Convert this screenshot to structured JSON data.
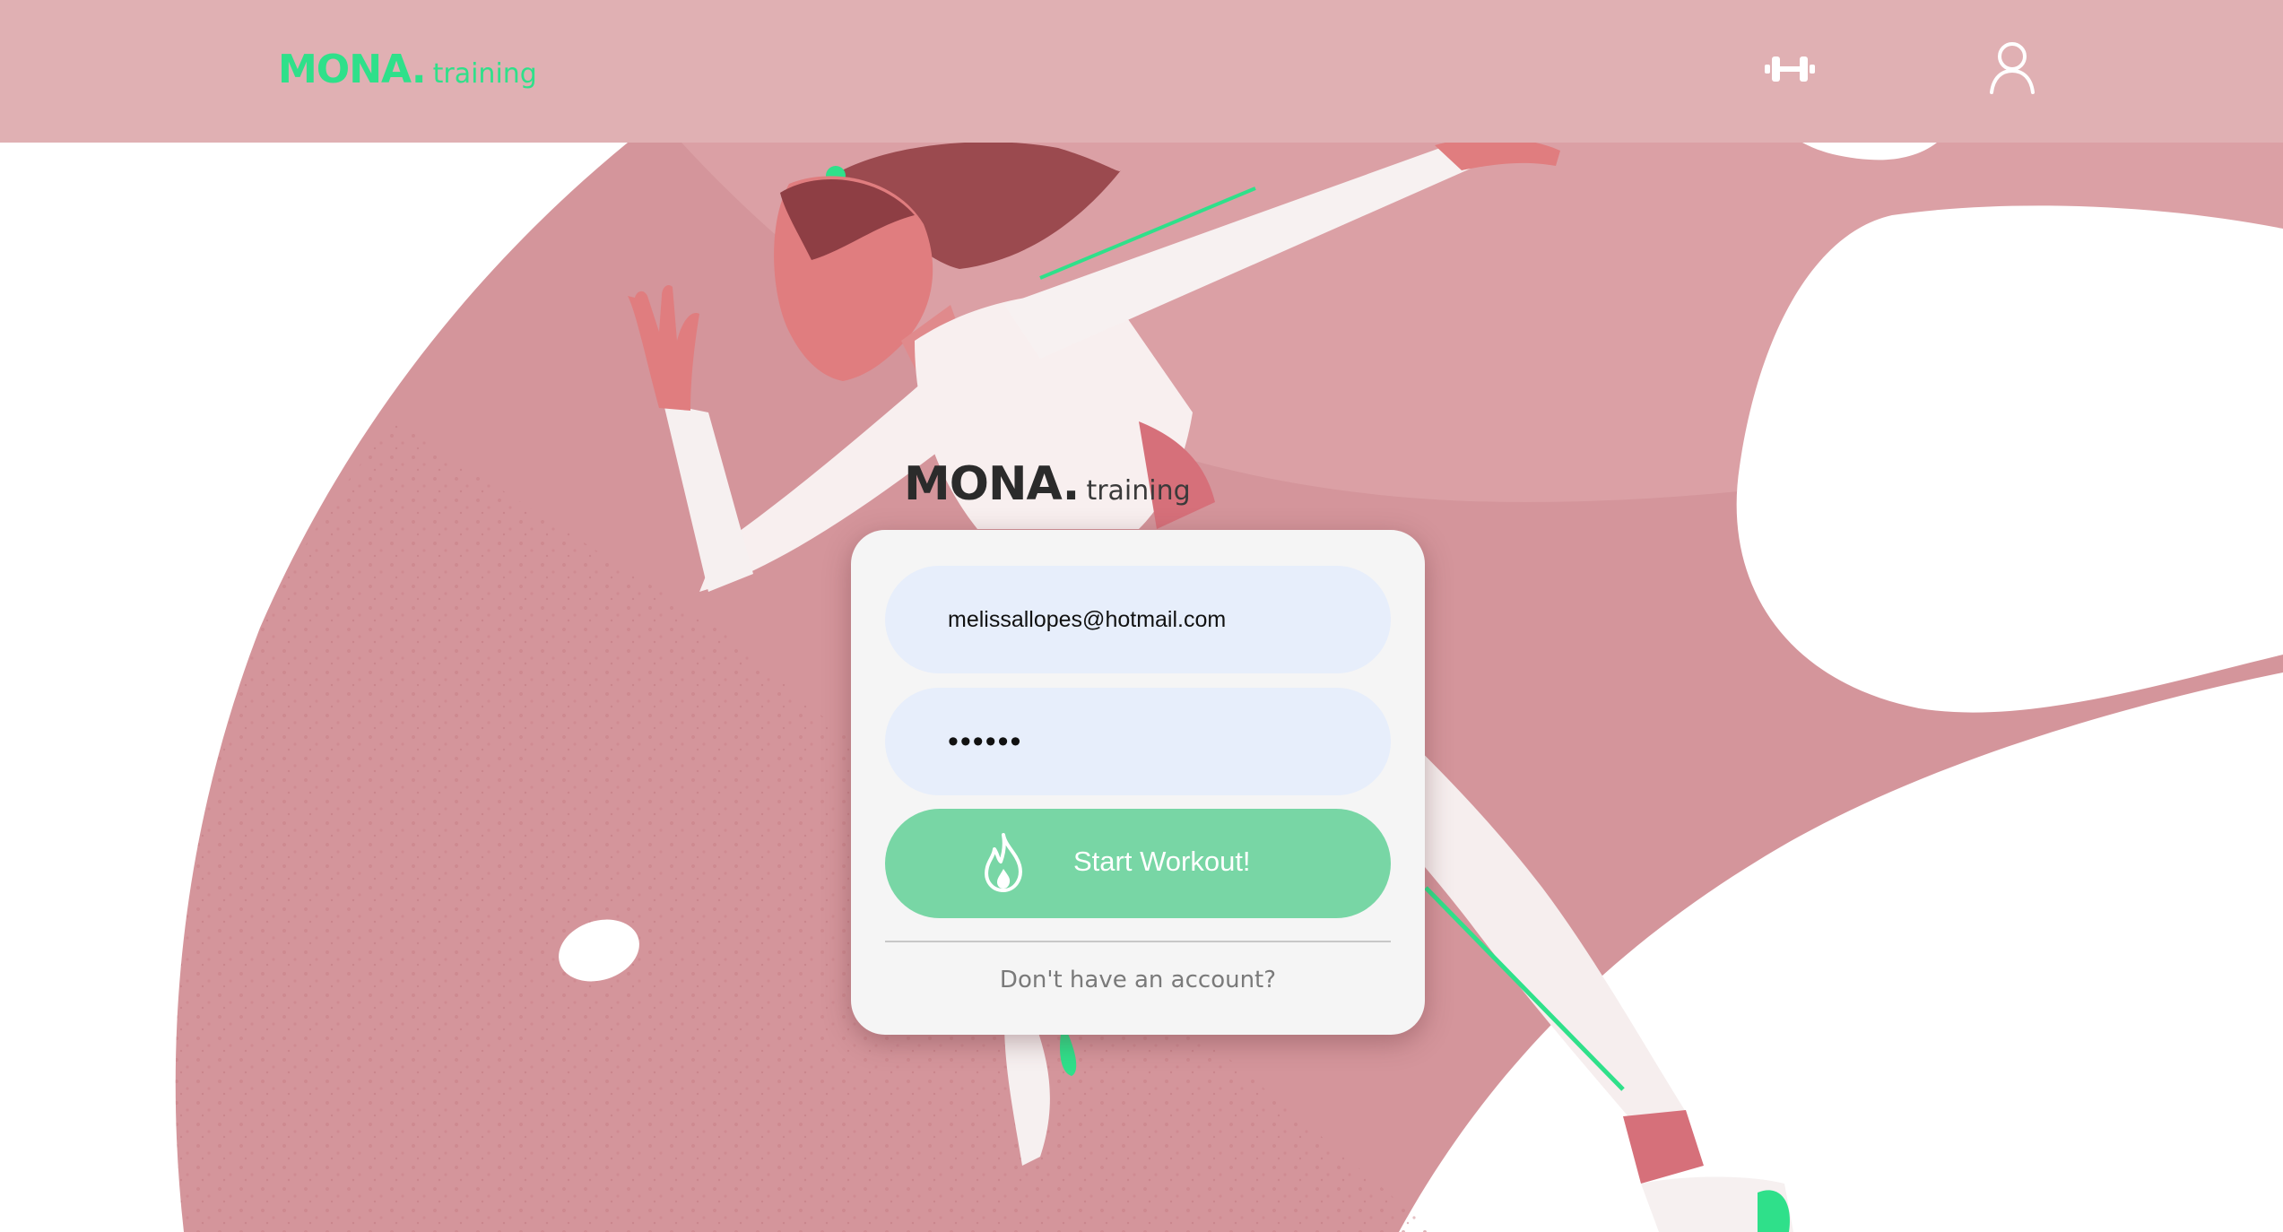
{
  "header": {
    "brand_main": "MONA.",
    "brand_sub": "training",
    "nav": [
      {
        "icon": "dumbbell-icon"
      },
      {
        "icon": "user-icon"
      }
    ]
  },
  "login": {
    "logo_main": "MONA.",
    "logo_sub": "training",
    "email_value": "melissallopes@hotmail.com",
    "password_value": "••••••",
    "submit_label": "Start Workout!",
    "submit_icon": "flame-icon",
    "signup_link": "Don't have an account?"
  },
  "colors": {
    "header_bg": "#e0b0b3",
    "brand_green": "#2fe08a",
    "button_green": "#78d6a5",
    "input_bg": "#e7eefb",
    "card_bg": "#f5f5f5",
    "illustration_pink": "#d4959b"
  }
}
